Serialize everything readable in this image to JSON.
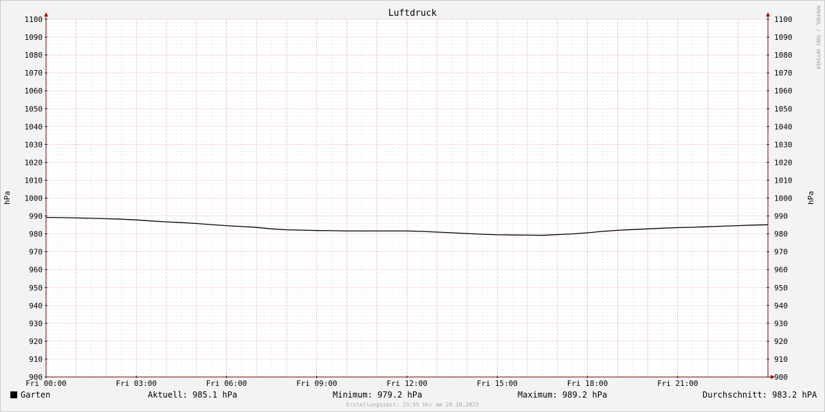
{
  "chart_data": {
    "type": "line",
    "title": "Luftdruck",
    "ylabel_left": "hPa",
    "ylabel_right": "hPa",
    "ylim": [
      900,
      1100
    ],
    "y_ticks": [
      900,
      910,
      920,
      930,
      940,
      950,
      960,
      970,
      980,
      990,
      1000,
      1010,
      1020,
      1030,
      1040,
      1050,
      1060,
      1070,
      1080,
      1090,
      1100
    ],
    "x_range_hours": [
      0,
      24
    ],
    "x_ticks": [
      {
        "hour": 0,
        "label": "Fri 00:00"
      },
      {
        "hour": 3,
        "label": "Fri 03:00"
      },
      {
        "hour": 6,
        "label": "Fri 06:00"
      },
      {
        "hour": 9,
        "label": "Fri 09:00"
      },
      {
        "hour": 12,
        "label": "Fri 12:00"
      },
      {
        "hour": 15,
        "label": "Fri 15:00"
      },
      {
        "hour": 18,
        "label": "Fri 18:00"
      },
      {
        "hour": 21,
        "label": "Fri 21:00"
      }
    ],
    "grid": true,
    "series": [
      {
        "name": "Garten",
        "color": "#000000",
        "x": [
          0,
          0.5,
          1,
          1.5,
          2,
          2.5,
          3,
          3.5,
          4,
          4.5,
          5,
          5.5,
          6,
          6.5,
          7,
          7.5,
          8,
          8.5,
          9,
          9.5,
          10,
          10.5,
          11,
          11.5,
          12,
          12.5,
          13,
          13.5,
          14,
          14.5,
          15,
          15.5,
          16,
          16.5,
          17,
          17.5,
          18,
          18.5,
          19,
          19.5,
          20,
          20.5,
          21,
          21.5,
          22,
          22.5,
          23,
          23.5,
          24
        ],
        "values": [
          989.2,
          989.1,
          988.9,
          988.7,
          988.5,
          988.2,
          987.8,
          987.2,
          986.7,
          986.3,
          985.8,
          985.2,
          984.6,
          984.1,
          983.6,
          982.8,
          982.3,
          982.1,
          981.9,
          981.8,
          981.6,
          981.6,
          981.6,
          981.6,
          981.6,
          981.4,
          981.0,
          980.6,
          980.2,
          979.8,
          979.5,
          979.4,
          979.3,
          979.2,
          979.6,
          980.0,
          980.6,
          981.4,
          982.0,
          982.4,
          982.8,
          983.2,
          983.5,
          983.7,
          984.0,
          984.3,
          984.6,
          984.9,
          985.1
        ]
      }
    ],
    "legend": {
      "series_label": "Garten",
      "current": "Aktuell: 985.1 hPa",
      "minimum": "Minimum: 979.2 hPa",
      "maximum": "Maximum: 989.2 hPa",
      "average": "Durchschnitt: 983.2 hPA"
    },
    "footer": "Erstellungszeit: 23:55 Uhr am 20.10.2023",
    "watermark": "RRDTOOL / TOBI OETIKER"
  }
}
